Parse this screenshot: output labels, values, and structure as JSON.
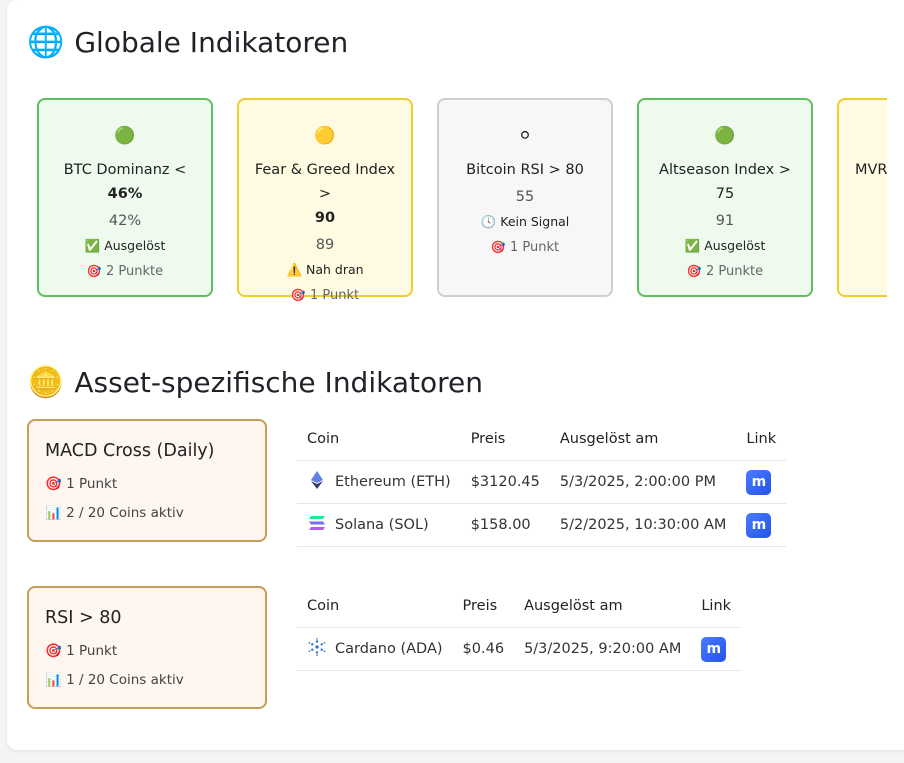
{
  "global": {
    "icon": "🌐",
    "title": "Globale Indikatoren",
    "cards": [
      {
        "dot": "🟢",
        "name": "BTC Dominanz <",
        "name_bold": "46%",
        "value": "42%",
        "status": "✅ Ausgelöst",
        "points_icon": "🎯",
        "points": "2 Punkte",
        "color": "green"
      },
      {
        "dot": "🟡",
        "name": "Fear & Greed Index >",
        "name_bold": "90",
        "value": "89",
        "status": "⚠️ Nah dran",
        "points_icon": "🎯",
        "points": "1 Punkt",
        "color": "yellow"
      },
      {
        "dot": "⚪",
        "name": "Bitcoin RSI > 80",
        "name_bold": "",
        "value": "55",
        "status": "🕓 Kein Signal",
        "points_icon": "🎯",
        "points": "1 Punkt",
        "color": "gray"
      },
      {
        "dot": "🟢",
        "name": "Altseason Index > 75",
        "name_bold": "",
        "value": "91",
        "status": "✅ Ausgelöst",
        "points_icon": "🎯",
        "points": "2 Punkte",
        "color": "green"
      },
      {
        "dot": "",
        "name": "MVRV",
        "name_bold": "",
        "value": "",
        "status": "",
        "points_icon": "",
        "points": "",
        "color": "yellow"
      }
    ]
  },
  "asset": {
    "icon": "🪙",
    "title": "Asset-spezifische Indikatoren",
    "columns": {
      "coin": "Coin",
      "price": "Preis",
      "triggered": "Ausgelöst am",
      "link": "Link"
    },
    "link_icon": "coinmarketcap-icon",
    "indicators": [
      {
        "title": "MACD Cross (Daily)",
        "points_icon": "🎯",
        "points": "1 Punkt",
        "coins_icon": "📊",
        "coins_active": "2 / 20 Coins aktiv",
        "rows": [
          {
            "icon": "ethereum-icon",
            "coin": "Ethereum (ETH)",
            "price": "$3120.45",
            "triggered": "5/3/2025, 2:00:00 PM"
          },
          {
            "icon": "solana-icon",
            "coin": "Solana (SOL)",
            "price": "$158.00",
            "triggered": "5/2/2025, 10:30:00 AM"
          }
        ]
      },
      {
        "title": "RSI > 80",
        "points_icon": "🎯",
        "points": "1 Punkt",
        "coins_icon": "📊",
        "coins_active": "1 / 20 Coins aktiv",
        "rows": [
          {
            "icon": "cardano-icon",
            "coin": "Cardano (ADA)",
            "price": "$0.46",
            "triggered": "5/3/2025, 9:20:00 AM"
          }
        ]
      }
    ]
  }
}
